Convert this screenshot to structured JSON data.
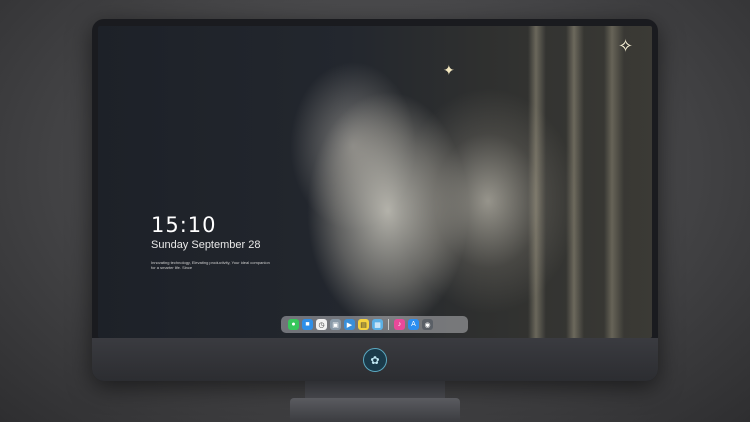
{
  "lockscreen": {
    "time": "15:10",
    "date": "Sunday September 28",
    "tagline": "Innovating technology, Elevating productivity, Your ideal companion for a smarter life. Since"
  },
  "dock": {
    "apps": [
      {
        "name": "messages-icon",
        "color": "#37c65b",
        "glyph": "●"
      },
      {
        "name": "finder-icon",
        "color": "#2f8fe8",
        "glyph": "■"
      },
      {
        "name": "clock-icon",
        "color": "#f2f2f2",
        "glyph": "◷"
      },
      {
        "name": "photos-icon",
        "color": "#8a9aa8",
        "glyph": "▣"
      },
      {
        "name": "video-icon",
        "color": "#3a8fd9",
        "glyph": "▶"
      },
      {
        "name": "notes-icon",
        "color": "#f6d33f",
        "glyph": "▤"
      },
      {
        "name": "preview-icon",
        "color": "#5bb0e6",
        "glyph": "▦"
      },
      {
        "name": "music-icon",
        "color": "#e9499a",
        "glyph": "♪"
      },
      {
        "name": "app-store-icon",
        "color": "#2c8ef0",
        "glyph": "A"
      },
      {
        "name": "camera-icon",
        "color": "#5a5f66",
        "glyph": "◉"
      }
    ]
  },
  "colors": {
    "bezel": "#1a1b1f",
    "chin": "#2c2d31",
    "background": "#4a4a4c"
  }
}
